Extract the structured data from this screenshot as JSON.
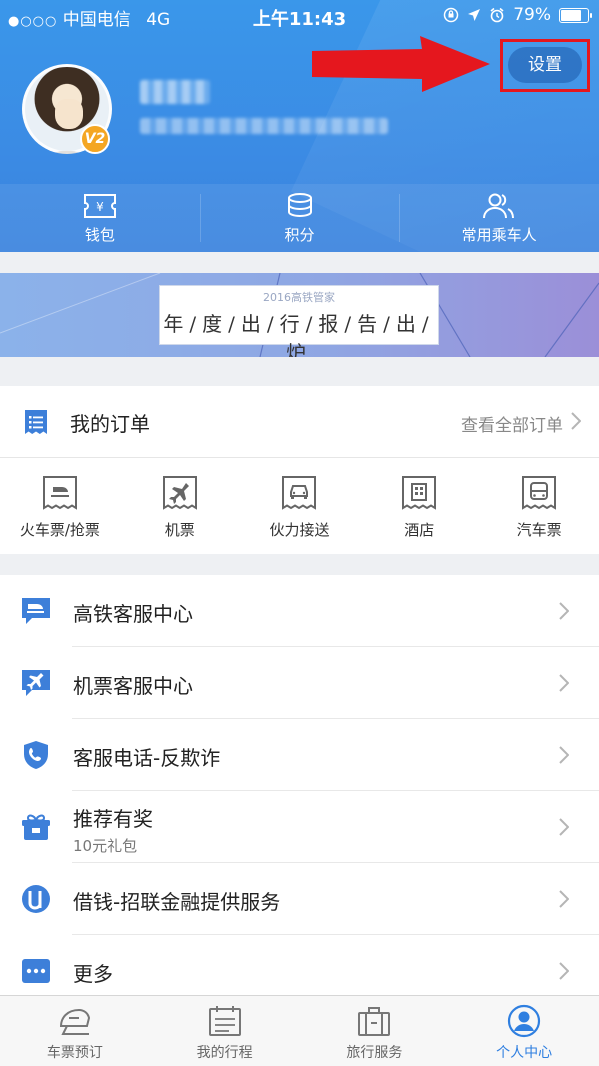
{
  "status_bar": {
    "carrier_dots": "●○○○",
    "carrier": "中国电信",
    "network": "4G",
    "time": "上午11:43",
    "battery_text": "79%",
    "battery_level": 0.79
  },
  "profile": {
    "level_badge": "V2"
  },
  "header": {
    "settings_label": "设置",
    "highlight_color": "#e5171e"
  },
  "quick_bar": [
    {
      "label": "钱包",
      "icon": "wallet-icon"
    },
    {
      "label": "积分",
      "icon": "coins-icon"
    },
    {
      "label": "常用乘车人",
      "icon": "passengers-icon"
    }
  ],
  "banner": {
    "small_text": "2016高铁管家",
    "title": "年/度/出/行/报/告/出/炉"
  },
  "orders": {
    "title": "我的订单",
    "view_all": "查看全部订单",
    "types": [
      {
        "label": "火车票/抢票",
        "icon": "train-ticket-icon"
      },
      {
        "label": "机票",
        "icon": "plane-ticket-icon"
      },
      {
        "label": "伙力接送",
        "icon": "car-pickup-icon"
      },
      {
        "label": "酒店",
        "icon": "hotel-icon"
      },
      {
        "label": "汽车票",
        "icon": "bus-ticket-icon"
      }
    ]
  },
  "menu": [
    {
      "label": "高铁客服中心",
      "sub": "",
      "icon": "train-service-icon"
    },
    {
      "label": "机票客服中心",
      "sub": "",
      "icon": "plane-service-icon"
    },
    {
      "label": "客服电话-反欺诈",
      "sub": "",
      "icon": "shield-phone-icon"
    },
    {
      "label": "推荐有奖",
      "sub": "10元礼包",
      "icon": "gift-icon"
    },
    {
      "label": "借钱-招联金融提供服务",
      "sub": "",
      "icon": "loan-icon"
    },
    {
      "label": "更多",
      "sub": "",
      "icon": "more-icon"
    }
  ],
  "tabbar": [
    {
      "label": "车票预订",
      "icon": "train-tab-icon",
      "active": false
    },
    {
      "label": "我的行程",
      "icon": "itinerary-tab-icon",
      "active": false
    },
    {
      "label": "旅行服务",
      "icon": "suitcase-tab-icon",
      "active": false
    },
    {
      "label": "个人中心",
      "icon": "profile-tab-icon",
      "active": true
    }
  ],
  "colors": {
    "header_blue": "#3a8be4",
    "accent_blue": "#2f7fe0",
    "icon_blue": "#3d7fd9"
  }
}
